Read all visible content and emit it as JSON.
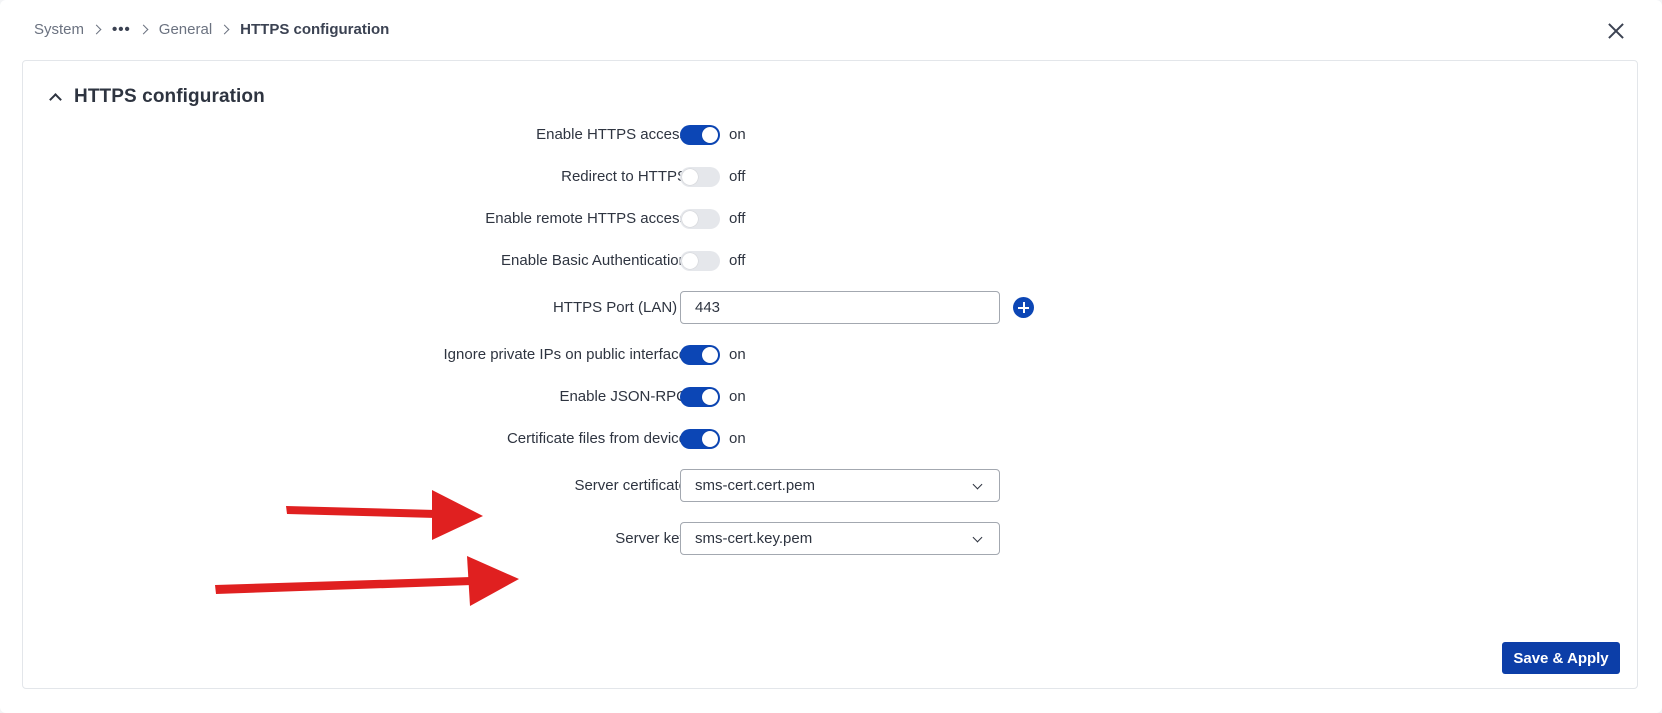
{
  "breadcrumb": {
    "items": [
      "System",
      "•••",
      "General",
      "HTTPS configuration"
    ]
  },
  "panel": {
    "title": "HTTPS configuration"
  },
  "fields": {
    "enable_https": {
      "label": "Enable HTTPS access",
      "state": "on"
    },
    "redirect_https": {
      "label": "Redirect to HTTPS",
      "state": "off"
    },
    "remote_https": {
      "label": "Enable remote HTTPS access",
      "state": "off"
    },
    "basic_auth": {
      "label": "Enable Basic Authentication",
      "state": "off"
    },
    "https_port": {
      "label": "HTTPS Port (LAN)",
      "required_mark": "*",
      "value": "443"
    },
    "ignore_private_ips": {
      "label": "Ignore private IPs on public interface",
      "state": "on"
    },
    "json_rpc": {
      "label": "Enable JSON-RPC",
      "state": "on"
    },
    "cert_from_device": {
      "label": "Certificate files from device",
      "state": "on"
    },
    "server_certificate": {
      "label": "Server certificate",
      "value": "sms-cert.cert.pem"
    },
    "server_key": {
      "label": "Server key",
      "value": "sms-cert.key.pem"
    }
  },
  "actions": {
    "save_apply_label": "Save & Apply"
  },
  "colors": {
    "accent": "#0c46b5",
    "toggle_off": "#e5e7eb",
    "annotation_arrow": "#e02020",
    "required": "#d32f2f"
  },
  "icons": [
    "chevron-right-icon",
    "more-horizontal-icon",
    "close-icon",
    "chevron-up-icon",
    "plus-circle-icon",
    "chevron-down-icon"
  ]
}
